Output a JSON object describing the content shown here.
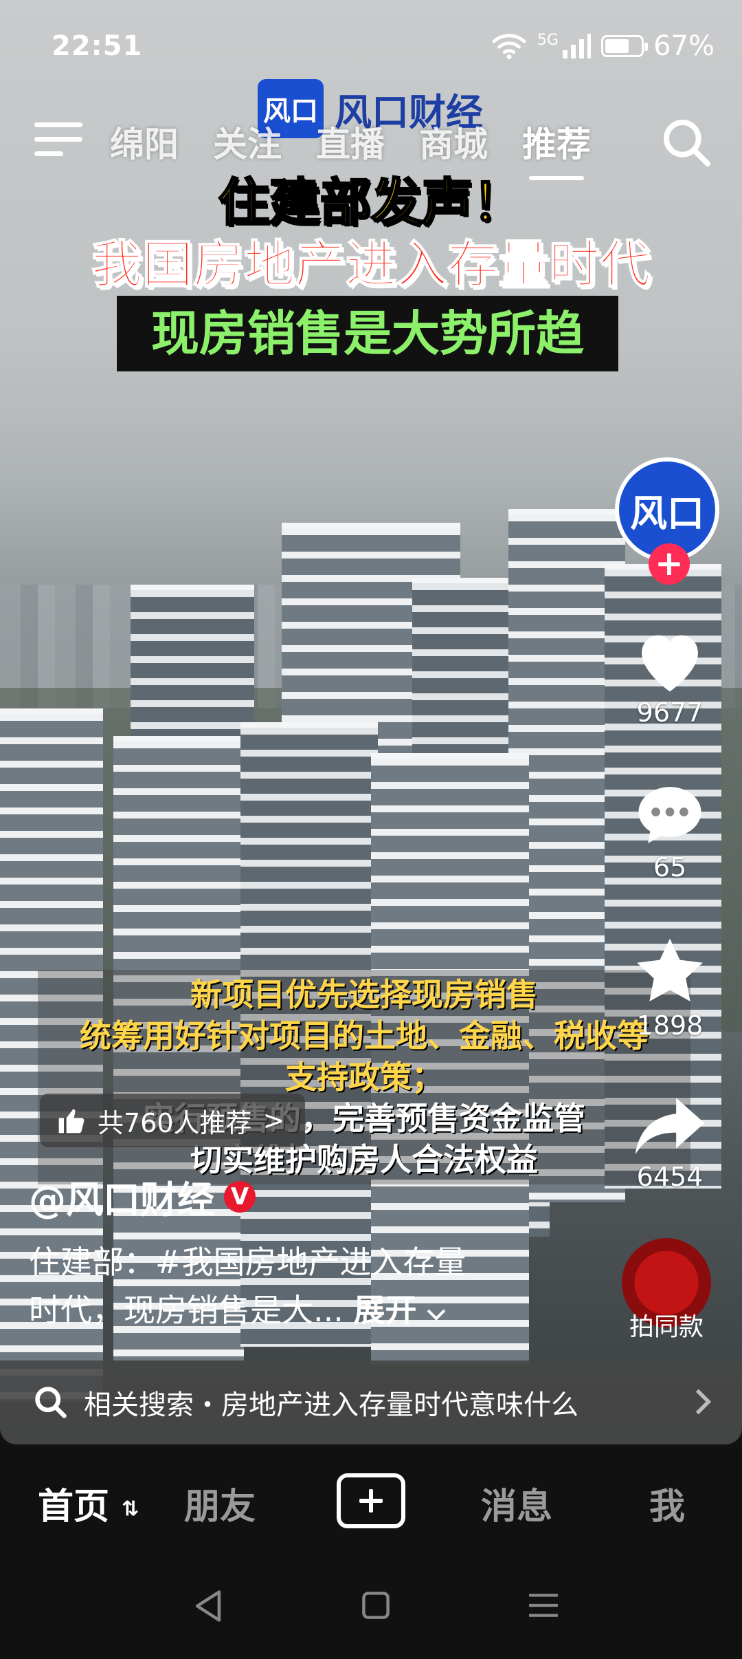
{
  "status_bar": {
    "time": "22:51",
    "network": "5G",
    "battery": "67%",
    "battery_level": 0.67
  },
  "top_nav": {
    "tabs": [
      "绵阳",
      "关注",
      "直播",
      "商城",
      "推荐"
    ],
    "active_tab": "推荐"
  },
  "video": {
    "logo_mark": "风口",
    "logo_text": "风口财经",
    "headline_1": "住建部发声！",
    "headline_2": "我国房地产进入存量时代",
    "headline_3": "现房销售是大势所趋",
    "subtitle_lines": [
      "新项目优先选择现房销售",
      "统筹用好针对项目的土地、金融、税收等",
      "支持政策；",
      "实行预售的，完善预售资金监管",
      "切实维护购房人合法权益"
    ]
  },
  "right_rail": {
    "avatar_text": "风口",
    "follow_label": "+",
    "likes": "9677",
    "comments": "65",
    "favorites": "1898",
    "shares": "6454",
    "same_style_label": "拍同款"
  },
  "recommend_pill": {
    "text": "共760人推荐",
    "arrow": ">"
  },
  "author": {
    "name": "@风口财经",
    "badge": "V"
  },
  "description": {
    "line1": "住建部：#我国房地产进入存量",
    "line2": "时代，现房销售是大...",
    "expand": "展开"
  },
  "related_search": {
    "text": "相关搜索・房地产进入存量时代意味什么"
  },
  "bottom_nav": {
    "home": "首页",
    "friends": "朋友",
    "messages": "消息",
    "me": "我"
  },
  "icons": [
    "menu-icon",
    "search-icon",
    "heart-icon",
    "comment-icon",
    "star-icon",
    "share-icon",
    "thumbs-up-icon",
    "plus-icon",
    "back-icon",
    "home-icon",
    "recents-icon"
  ]
}
